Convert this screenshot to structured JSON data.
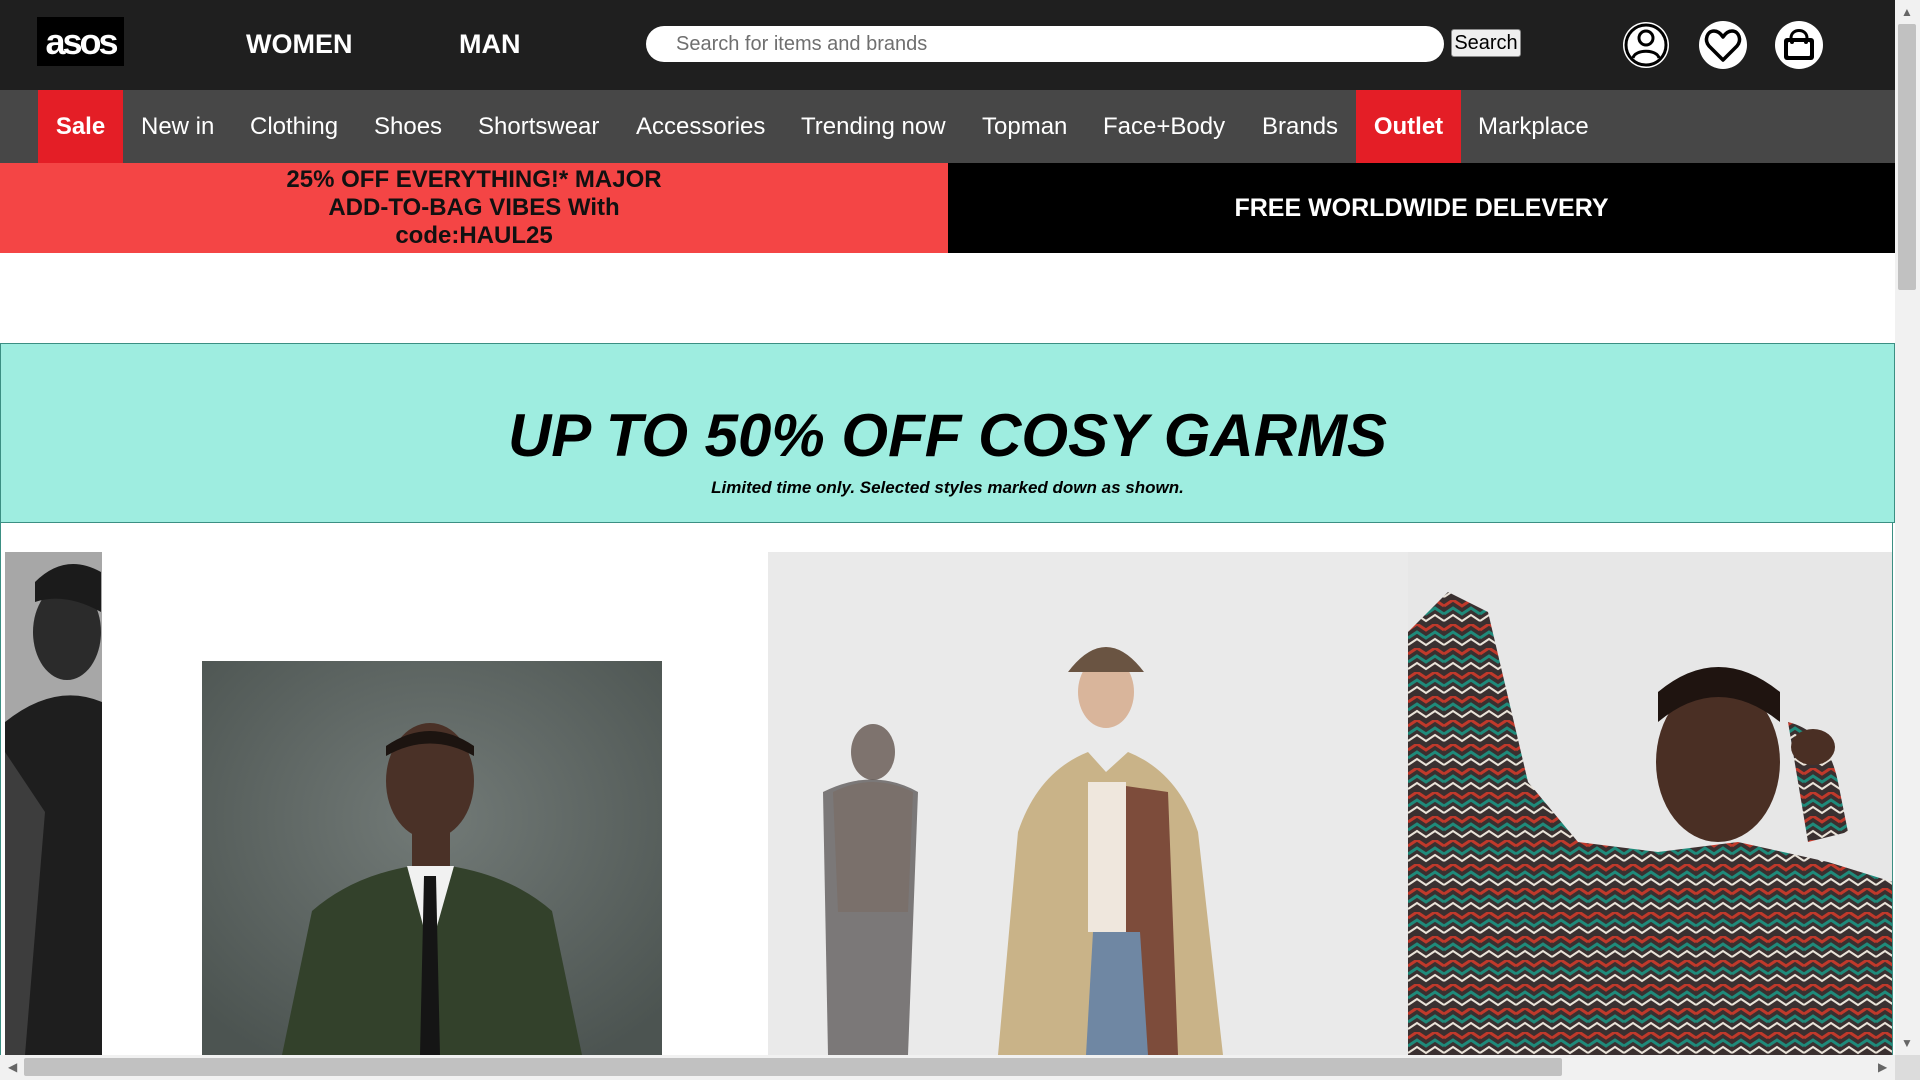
{
  "header": {
    "logo": "asos",
    "gender_tabs": [
      "WOMEN",
      "MAN"
    ],
    "search_placeholder": "Search for items and brands",
    "search_button": "Search",
    "icons": [
      "account-icon",
      "heart-icon",
      "shopping-bag-icon"
    ]
  },
  "nav": {
    "items": [
      "Sale",
      "New in",
      "Clothing",
      "Shoes",
      "Shortswear",
      "Accessories",
      "Trending now",
      "Topman",
      "Face+Body",
      "Brands",
      "Outlet",
      "Markplace"
    ],
    "highlighted": [
      "Sale",
      "Outlet"
    ],
    "highlight_color": "#e41e26"
  },
  "promo": {
    "left_lines": [
      "25% OFF EVERYTHING!* MAJOR",
      "ADD-TO-BAG VIBES With",
      "code:HAUL25"
    ],
    "left_color": "#f44545",
    "right": "FREE WORLDWIDE DELEVERY"
  },
  "banner": {
    "title": "UP TO 50% OFF COSY GARMS",
    "subtitle": "Limited time only. Selected styles marked down as shown.",
    "color": "#9eede0"
  },
  "photos": [
    "model-black-jacket",
    "model-green-suit",
    "model-patchwork-coat",
    "model-knit-sweater"
  ]
}
